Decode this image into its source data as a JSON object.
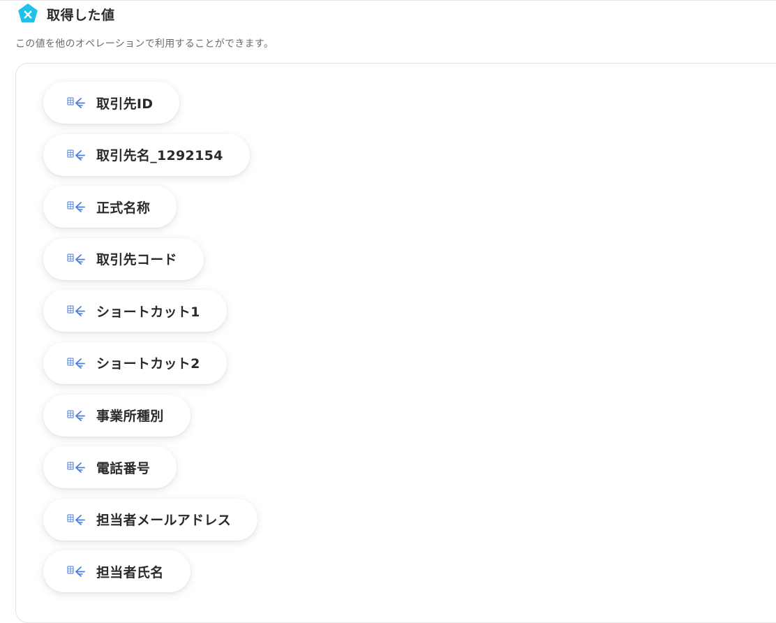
{
  "header": {
    "title": "取得した値",
    "icon": "app-logo-icon"
  },
  "description": "この値を他のオペレーションで利用することができます。",
  "colors": {
    "brand": "#1ec2e8",
    "chip_icon": "#4a7fd8"
  },
  "values": [
    {
      "label": "取引先ID",
      "icon": "data-field-icon"
    },
    {
      "label": "取引先名_1292154",
      "icon": "data-field-icon"
    },
    {
      "label": "正式名称",
      "icon": "data-field-icon"
    },
    {
      "label": "取引先コード",
      "icon": "data-field-icon"
    },
    {
      "label": "ショートカット1",
      "icon": "data-field-icon"
    },
    {
      "label": "ショートカット2",
      "icon": "data-field-icon"
    },
    {
      "label": "事業所種別",
      "icon": "data-field-icon"
    },
    {
      "label": "電話番号",
      "icon": "data-field-icon"
    },
    {
      "label": "担当者メールアドレス",
      "icon": "data-field-icon"
    },
    {
      "label": "担当者氏名",
      "icon": "data-field-icon"
    }
  ]
}
